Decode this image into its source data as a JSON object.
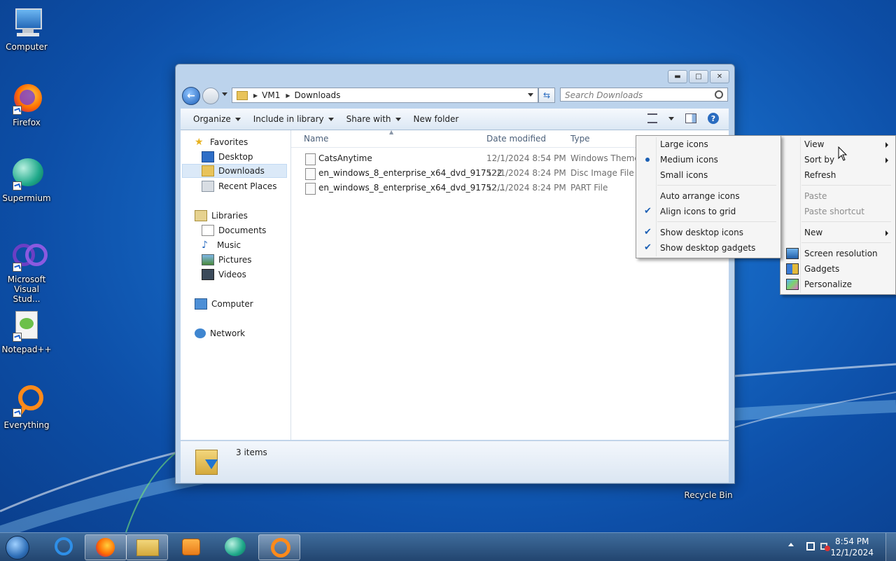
{
  "desktop": {
    "icons": [
      {
        "label": "Computer"
      },
      {
        "label": "Firefox"
      },
      {
        "label": "Supermium"
      },
      {
        "label": "Microsoft Visual Stud..."
      },
      {
        "label": "Notepad++"
      },
      {
        "label": "Everything"
      },
      {
        "label": "Recycle Bin"
      }
    ]
  },
  "explorer": {
    "address": {
      "root": "VM1",
      "folder": "Downloads"
    },
    "search_placeholder": "Search Downloads",
    "toolbar": {
      "organize": "Organize",
      "include_in_library": "Include in library",
      "share_with": "Share with",
      "new_folder": "New folder"
    },
    "nav": {
      "favorites": "Favorites",
      "desktop": "Desktop",
      "downloads": "Downloads",
      "recent_places": "Recent Places",
      "libraries": "Libraries",
      "documents": "Documents",
      "music": "Music",
      "pictures": "Pictures",
      "videos": "Videos",
      "computer": "Computer",
      "network": "Network"
    },
    "columns": {
      "name": "Name",
      "date_modified": "Date modified",
      "type": "Type"
    },
    "files": [
      {
        "name": "CatsAnytime",
        "date": "12/1/2024 8:54 PM",
        "type": "Windows Theme"
      },
      {
        "name": "en_windows_8_enterprise_x64_dvd_917522",
        "date": "12/1/2024 8:24 PM",
        "type": "Disc Image File"
      },
      {
        "name": "en_windows_8_enterprise_x64_dvd_91752...",
        "date": "12/1/2024 8:24 PM",
        "type": "PART File"
      }
    ],
    "status": "3 items"
  },
  "context_menu": {
    "view": "View",
    "sort_by": "Sort by",
    "refresh": "Refresh",
    "paste": "Paste",
    "paste_shortcut": "Paste shortcut",
    "new": "New",
    "screen_resolution": "Screen resolution",
    "gadgets": "Gadgets",
    "personalize": "Personalize"
  },
  "view_submenu": {
    "large_icons": "Large icons",
    "medium_icons": "Medium icons",
    "small_icons": "Small icons",
    "auto_arrange": "Auto arrange icons",
    "align_grid": "Align icons to grid",
    "show_desktop_icons": "Show desktop icons",
    "show_desktop_gadgets": "Show desktop gadgets"
  },
  "taskbar": {
    "time": "8:54 PM",
    "date": "12/1/2024"
  },
  "colors": {
    "accent": "#1a5fb4",
    "desktop": "#1668c4"
  }
}
